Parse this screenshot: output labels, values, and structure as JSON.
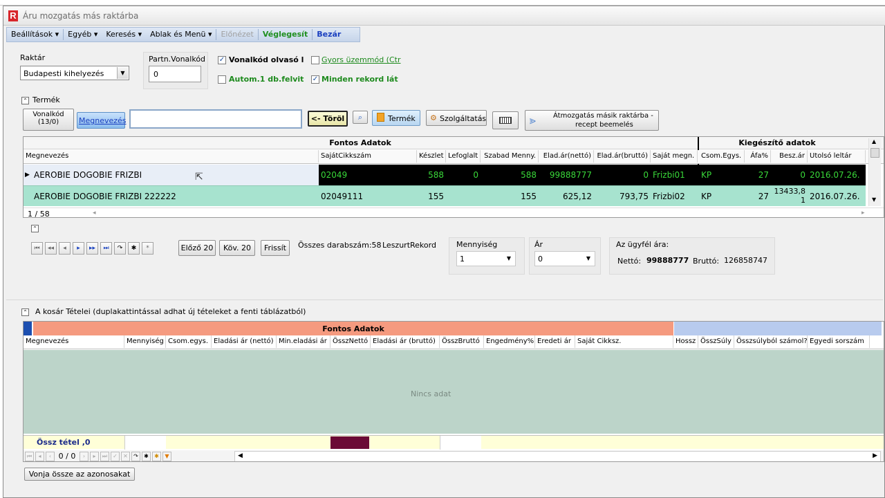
{
  "window": {
    "title": "Áru mozgatás más raktárba",
    "logo_letter": "R"
  },
  "menu": {
    "items": [
      "Beállítások ▾",
      "Egyéb ▾",
      "Keresés ▾",
      "Ablak és Menü ▾",
      "Előnézet",
      "Véglegesít",
      "Bezár"
    ]
  },
  "filters": {
    "warehouse_label": "Raktár",
    "warehouse_value": "Budapesti kihelyezés",
    "partner_barcode_label": "Partn.Vonalkód",
    "partner_barcode_value": "0",
    "chk_barcode_reader": "Vonalkód olvasó l",
    "chk_fast_mode": "Gyors üzemmód (Ctr",
    "chk_auto_qty": "Autom.1 db.felvit",
    "chk_all_records": "Minden rekord lát"
  },
  "product": {
    "section_label": "Termék",
    "barcode_btn_line1": "Vonalkód",
    "barcode_btn_line2": "(13/0)",
    "name_btn": "Megnevezés",
    "search_value": "",
    "clear_btn": "<- Töröl",
    "product_btn": "Termék",
    "service_btn": "Szolgáltatás",
    "transfer_btn_line1": "Átmozgatás másik raktárba -",
    "transfer_btn_line2": "recept beemelés"
  },
  "product_grid": {
    "band_important": "Fontos Adatok",
    "band_extra": "Kiegészítő adatok",
    "columns": [
      "Megnevezés",
      "SajátCikkszám",
      "Készlet",
      "Lefoglalt",
      "Szabad Menny.",
      "Elad.ár(nettó)",
      "Elad.ár(bruttó)",
      "Saját megn.",
      "Csom.Egys.",
      "Áfa%",
      "Besz.ár",
      "Utolsó leltár"
    ],
    "rows": [
      {
        "name": "AEROBIE DOGOBIE FRIZBI",
        "sku": "02049",
        "stock": "588",
        "reserved": "0",
        "free": "588",
        "net": "99888777",
        "gross": "0",
        "own": "Frizbi01",
        "unit": "KP",
        "vat": "27",
        "buy": "0",
        "inv": "2016.07.26."
      },
      {
        "name": "AEROBIE DOGOBIE FRIZBI 222222",
        "sku": "02049111",
        "stock": "155",
        "reserved": "",
        "free": "155",
        "net": "625,12",
        "gross": "793,75",
        "own": "Frizbi02",
        "unit": "KP",
        "vat": "27",
        "buy_line1": "13433,8",
        "buy_line2": "1",
        "inv": "2016.07.26."
      }
    ],
    "pager": "1 / 58"
  },
  "navigator": {
    "prev20": "Előző 20",
    "next20": "Köv. 20",
    "refresh": "Frissít",
    "total_text": "Összes darabszám:58",
    "filtered_text": "LeszurtRekord",
    "qty_label": "Mennyiség",
    "qty_value": "1",
    "price_label": "Ár",
    "price_value": "0",
    "customer_price_label": "Az ügyfél ára:",
    "net_label": "Nettó:",
    "net_value": "99888777",
    "gross_label": "Bruttó:",
    "gross_value": "126858747"
  },
  "basket": {
    "section_label": "A kosár Tételei (duplakattintással adhat új tételeket a fenti táblázatból)",
    "band_important": "Fontos Adatok",
    "columns": [
      "Megnevezés",
      "Mennyiség",
      "Csom.egys.",
      "Eladási ár (nettó)",
      "Min.eladási ár",
      "ÖsszNettó",
      "Eladási ár (bruttó)",
      "ÖsszBruttó",
      "Engedmény%",
      "Eredeti ár",
      "Saját Cikksz.",
      "Hossz",
      "ÖsszSúly",
      "Összsúlyból számol?",
      "Egyedi sorszám"
    ],
    "empty_text": "Nincs adat",
    "footer_total": "Össz tétel ,0",
    "pager": "0 / 0",
    "merge_btn": "Vonja össze az azonosakat"
  },
  "colors": {
    "selected_row_bg": "#000000",
    "selected_row_fg": "#39d839",
    "row_bg": "#a7e3cf",
    "band_salmon": "#f59a7f",
    "band_blue": "#b8cbee",
    "basket_bg": "#bcd4c9",
    "footer_bg": "#ffffd8",
    "summary_swatch": "#6b0a36"
  }
}
